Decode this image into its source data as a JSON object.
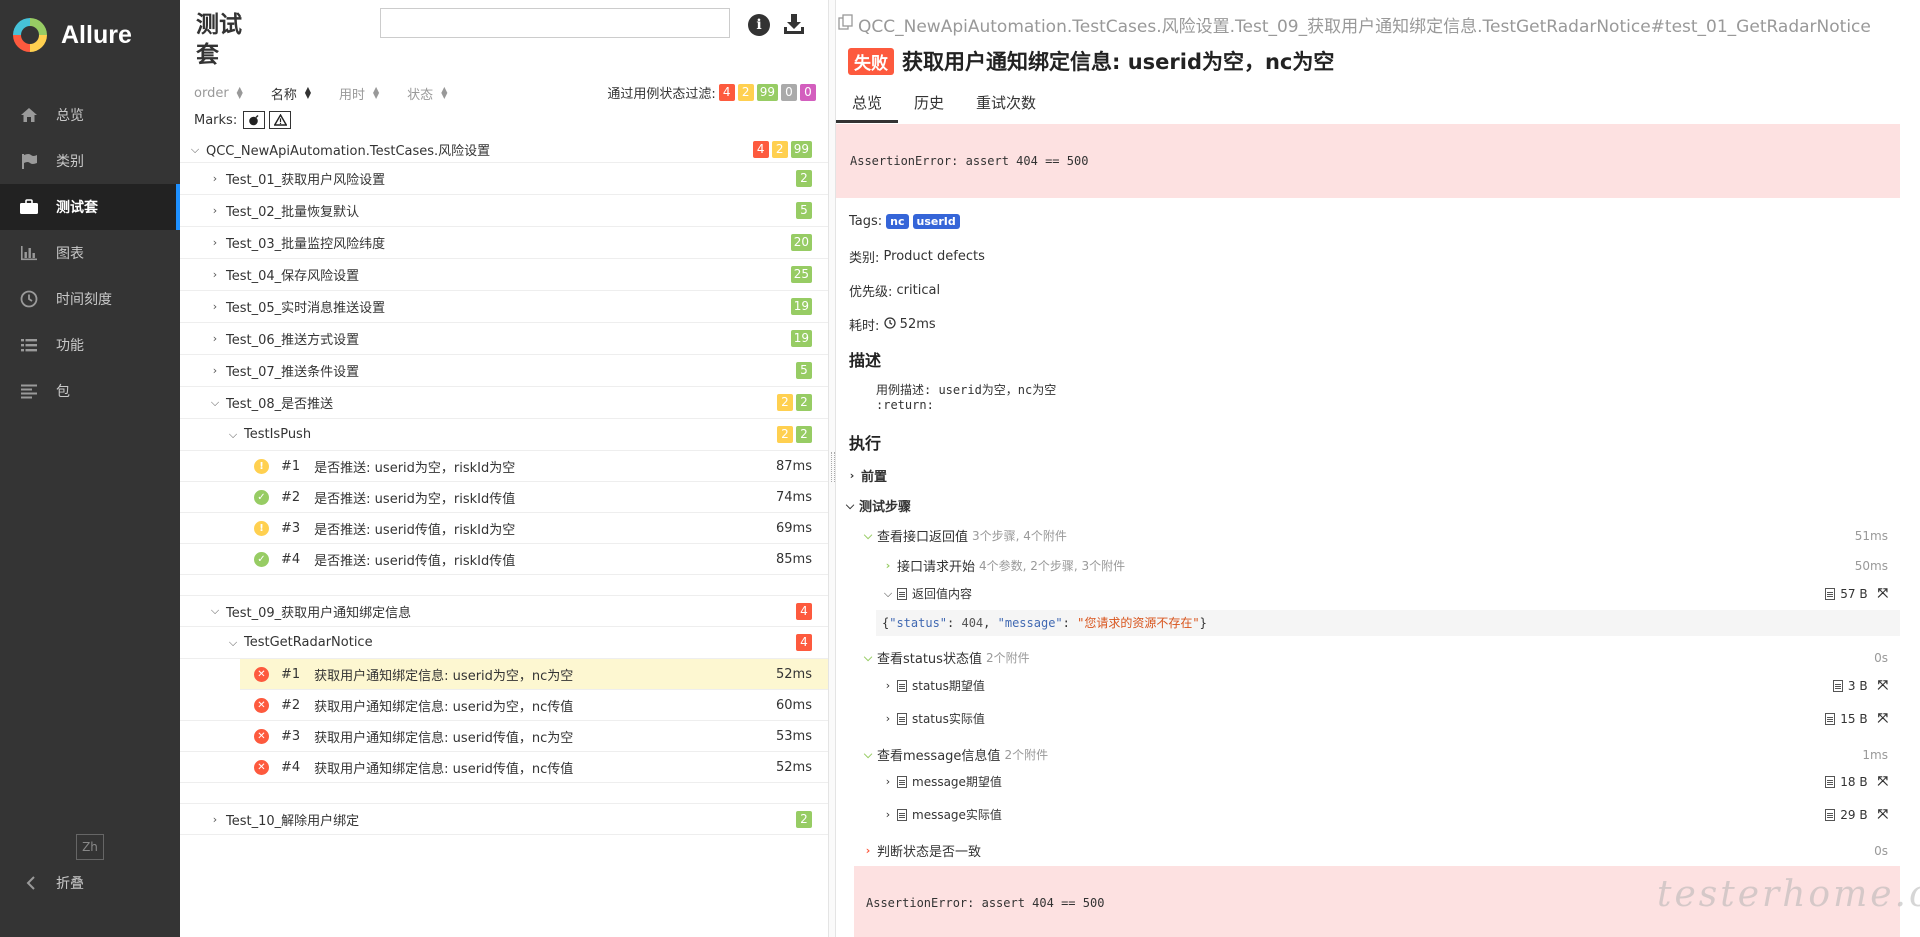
{
  "sidebar": {
    "brand": "Allure",
    "items": [
      {
        "label": "总览",
        "icon": "home-icon"
      },
      {
        "label": "类别",
        "icon": "flag-icon"
      },
      {
        "label": "测试套",
        "icon": "briefcase-icon",
        "active": true
      },
      {
        "label": "图表",
        "icon": "bar-chart-icon"
      },
      {
        "label": "时间刻度",
        "icon": "clock-icon"
      },
      {
        "label": "功能",
        "icon": "list-icon"
      },
      {
        "label": "包",
        "icon": "align-left-icon"
      }
    ],
    "lang": "Zh",
    "collapse": "折叠"
  },
  "tree": {
    "title": "测试套",
    "search_placeholder": "",
    "sort": {
      "order": "order",
      "name": "名称",
      "duration": "用时",
      "status": "状态"
    },
    "filter_label": "通过用例状态过滤:",
    "filter_counts": {
      "failed": "4",
      "broken": "2",
      "passed": "99",
      "skipped": "0",
      "unknown": "0"
    },
    "marks_label": "Marks:",
    "root": {
      "label": "QCC_NewApiAutomation.TestCases.风险设置",
      "failed": "4",
      "broken": "2",
      "passed": "99"
    },
    "suites": [
      {
        "label": "Test_01_获取用户风险设置",
        "passed": "2"
      },
      {
        "label": "Test_02_批量恢复默认",
        "passed": "5"
      },
      {
        "label": "Test_03_批量监控风险纬度",
        "passed": "20"
      },
      {
        "label": "Test_04_保存风险设置",
        "passed": "25"
      },
      {
        "label": "Test_05_实时消息推送设置",
        "passed": "19"
      },
      {
        "label": "Test_06_推送方式设置",
        "passed": "19"
      },
      {
        "label": "Test_07_推送条件设置",
        "passed": "5"
      }
    ],
    "suite08": {
      "label": "Test_08_是否推送",
      "broken": "2",
      "passed": "2",
      "class": {
        "label": "TestIsPush",
        "broken": "2",
        "passed": "2"
      },
      "cases": [
        {
          "num": "#1",
          "label": "是否推送: userid为空，riskId为空",
          "dur": "87ms",
          "status": "broken"
        },
        {
          "num": "#2",
          "label": "是否推送: userid为空，riskId传值",
          "dur": "74ms",
          "status": "passed"
        },
        {
          "num": "#3",
          "label": "是否推送: userid传值，riskId为空",
          "dur": "69ms",
          "status": "broken"
        },
        {
          "num": "#4",
          "label": "是否推送: userid传值，riskId传值",
          "dur": "85ms",
          "status": "passed"
        }
      ]
    },
    "suite09": {
      "label": "Test_09_获取用户通知绑定信息",
      "failed": "4",
      "class": {
        "label": "TestGetRadarNotice",
        "failed": "4"
      },
      "cases": [
        {
          "num": "#1",
          "label": "获取用户通知绑定信息: userid为空，nc为空",
          "dur": "52ms",
          "status": "failed"
        },
        {
          "num": "#2",
          "label": "获取用户通知绑定信息: userid为空，nc传值",
          "dur": "60ms",
          "status": "failed"
        },
        {
          "num": "#3",
          "label": "获取用户通知绑定信息: userid传值，nc为空",
          "dur": "53ms",
          "status": "failed"
        },
        {
          "num": "#4",
          "label": "获取用户通知绑定信息: userid传值，nc传值",
          "dur": "52ms",
          "status": "failed"
        }
      ]
    },
    "suite10": {
      "label": "Test_10_解除用户绑定",
      "passed": "2"
    }
  },
  "detail": {
    "path": "QCC_NewApiAutomation.TestCases.风险设置.Test_09_获取用户通知绑定信息.TestGetRadarNotice#test_01_GetRadarNotice",
    "status": "失败",
    "title": "获取用户通知绑定信息: userid为空，nc为空",
    "tabs": [
      "总览",
      "历史",
      "重试次数"
    ],
    "error": "AssertionError: assert 404 == 500",
    "tags_label": "Tags:",
    "tags": [
      "nc",
      "userId"
    ],
    "category_label": "类别:",
    "category": "Product defects",
    "severity_label": "优先级:",
    "severity": "critical",
    "duration_label": "耗时:",
    "duration": "52ms",
    "desc_heading": "描述",
    "desc_line1": "用例描述: userid为空，nc为空",
    "desc_line2": ":return:",
    "exec_heading": "执行",
    "setup": "前置",
    "steps_label": "测试步骤",
    "step1": {
      "label": "查看接口返回值",
      "sub": "3个步骤, 4个附件",
      "dur": "51ms"
    },
    "step1a": {
      "label": "接口请求开始",
      "sub": "4个参数, 2个步骤, 3个附件",
      "dur": "50ms"
    },
    "step1b": {
      "label": "返回值内容",
      "size": "57 B"
    },
    "json": {
      "k1": "\"status\"",
      "v1": "404",
      "k2": "\"message\"",
      "v2": "\"您请求的资源不存在\""
    },
    "step2": {
      "label": "查看status状态值",
      "sub": "2个附件",
      "dur": "0s"
    },
    "step2a": {
      "label": "status期望值",
      "size": "3 B"
    },
    "step2b": {
      "label": "status实际值",
      "size": "15 B"
    },
    "step3": {
      "label": "查看message信息值",
      "sub": "2个附件",
      "dur": "1ms"
    },
    "step3a": {
      "label": "message期望值",
      "size": "18 B"
    },
    "step3b": {
      "label": "message实际值",
      "size": "29 B"
    },
    "step4": {
      "label": "判断状态是否一致",
      "dur": "0s"
    },
    "error2": "AssertionError: assert 404 == 500"
  },
  "watermark": "testerhome.com"
}
